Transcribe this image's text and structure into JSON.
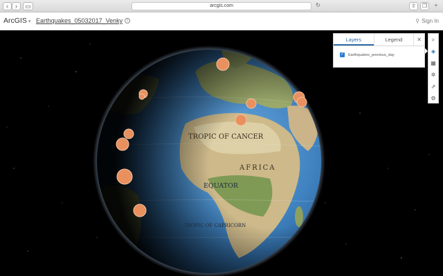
{
  "browser": {
    "url": "arcgis.com",
    "back_icon": "chevron-left-icon",
    "forward_icon": "chevron-right-icon"
  },
  "header": {
    "brand": "ArcGIS",
    "title": "Earthquakes_05032017_Venky",
    "signin": "Sign In"
  },
  "panel": {
    "tabs": [
      {
        "label": "Layers",
        "active": true
      },
      {
        "label": "Legend",
        "active": false
      }
    ],
    "layers": [
      {
        "name": "Earthquakes_previous_day",
        "checked": true
      }
    ]
  },
  "toolbar": {
    "tools": [
      "search-icon",
      "layers-icon",
      "basemap-icon",
      "settings-icon",
      "share-icon",
      "measure-icon"
    ]
  },
  "map": {
    "labels": {
      "tropic_cancer": "TROPIC OF CANCER",
      "africa": "AFRICA",
      "equator": "EQUATOR",
      "tropic_capricorn": "TROPIC OF CAPRICORN"
    }
  },
  "colors": {
    "accent": "#2b6ea8",
    "quake": "#e8905e",
    "ocean": "#3f82c0"
  }
}
